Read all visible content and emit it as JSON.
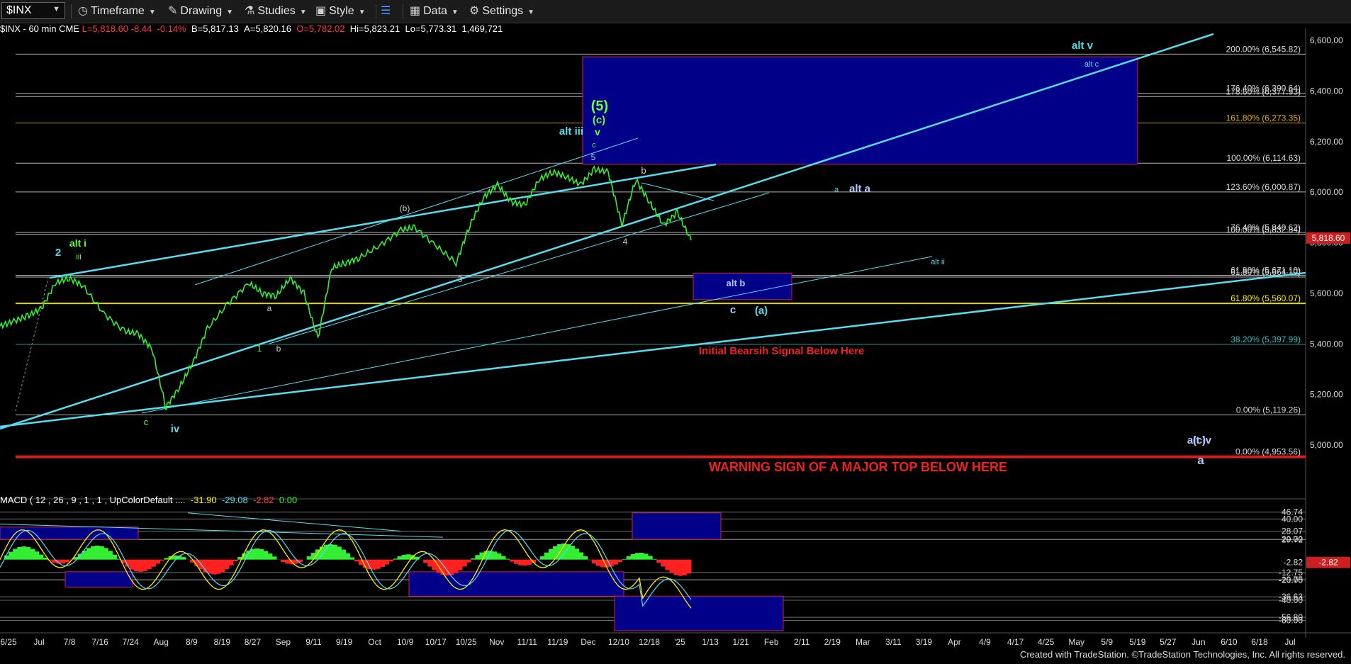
{
  "toolbar": {
    "symbol": "$INX",
    "items": [
      {
        "label": "Timeframe",
        "icon": "clock-icon"
      },
      {
        "label": "Drawing",
        "icon": "pencil-icon"
      },
      {
        "label": "Studies",
        "icon": "flask-icon"
      },
      {
        "label": "Style",
        "icon": "style-icon"
      },
      {
        "label": "",
        "icon": "panel-icon"
      },
      {
        "label": "Data",
        "icon": "bar-chart-icon"
      },
      {
        "label": "Settings",
        "icon": "gear-icon"
      }
    ]
  },
  "header": {
    "symbol": "$INX - 60 min  CME",
    "last": "L=5,818.60",
    "change": "-8.44",
    "pct": "-0.14%",
    "bid": "B=5,817.13",
    "ask": "A=5,820.16",
    "open": "O=5,782.02",
    "high": "Hi=5,823.21",
    "low": "Lo=5,773.31",
    "volume": "1,469,721"
  },
  "macd": {
    "label": "MACD ( 12 , 26 , 9 , 1 , 1 , UpColorDefault ....",
    "v1": "-31.90",
    "v2": "-29.08",
    "v3": "-2.82",
    "v4": "0.00"
  },
  "credit": "Created with TradeStation. ©TradeStation Technologies, Inc. All rights reserved.",
  "colors": {
    "price": "#33ee33",
    "cyan": "#55ddee",
    "blue_box": "#000088",
    "red": "#ee2222",
    "yellow": "#ffee00",
    "green_label": "#66ff33"
  },
  "chart_data": {
    "type": "line",
    "title": "",
    "x_ticks": [
      "6/25",
      "Jul",
      "7/8",
      "7/16",
      "7/24",
      "Aug",
      "8/9",
      "8/19",
      "8/27",
      "Sep",
      "9/11",
      "9/19",
      "Oct",
      "10/9",
      "10/17",
      "10/25",
      "Nov",
      "11/11",
      "11/19",
      "Dec",
      "12/10",
      "12/18",
      "'25",
      "1/13",
      "1/21",
      "Feb",
      "2/11",
      "2/19",
      "Mar",
      "3/11",
      "3/19",
      "Apr",
      "4/9",
      "4/17",
      "4/25",
      "May",
      "5/9",
      "5/19",
      "5/27",
      "Jun",
      "6/10",
      "6/18",
      "Jul"
    ],
    "price_ticks": [
      "6,600.00",
      "6,400.00",
      "6,200.00",
      "6,000.00",
      "5,800.00",
      "5,600.00",
      "5,400.00",
      "5,200.00",
      "5,000.00"
    ],
    "price_ylim": [
      4900,
      6650
    ],
    "last_price": "5,818.60",
    "fib_levels": [
      {
        "label": "200.00% (6,545.82)",
        "value": 6545.82
      },
      {
        "label": "178.60% (6,377.93)",
        "value": 6377.93
      },
      {
        "label": "176.40% (6,390.64)",
        "value": 6390.64
      },
      {
        "label": "161.80% (6,273.35)",
        "value": 6273.35
      },
      {
        "label": "100.00% (6,114.63)",
        "value": 6114.63
      },
      {
        "label": "123.60% (6,000.87)",
        "value": 6000.87
      },
      {
        "label": "76.40% (5,840.62)",
        "value": 5840.62
      },
      {
        "label": "100.00% (5,832.84)",
        "value": 5832.84
      },
      {
        "label": "61.80% (5,671.10)",
        "value": 5671.1
      },
      {
        "label": "61.80% (5,664.10)",
        "value": 5664.1
      },
      {
        "label": "61.80% (5,560.07)",
        "value": 5560.07
      },
      {
        "label": "38.20% (5,397.99)",
        "value": 5397.99
      },
      {
        "label": "0.00% (5,119.26)",
        "value": 5119.26
      },
      {
        "label": "0.00% (4,953.56)",
        "value": 4953.56
      }
    ],
    "wave_labels": [
      "alt v",
      "alt c",
      "(5)",
      "(c)",
      "alt iii",
      "v",
      "c",
      "5",
      "b",
      "a",
      "alt a",
      "(b)",
      "3",
      "4",
      "a",
      "1",
      "b",
      "2",
      "alt i",
      "iii",
      "c",
      "iv",
      "alt ii",
      "alt b",
      "c",
      "(a)",
      "alt iv",
      "(c)",
      "a"
    ],
    "annotations": [
      "Initial Bearsih Signal Below Here",
      "WARNING SIGN OF A MAJOR TOP BELOW HERE"
    ],
    "price_series": {
      "name": "",
      "x": [
        0,
        0.02,
        0.04,
        0.06,
        0.08,
        0.1,
        0.12,
        0.15,
        0.18,
        0.2,
        0.22,
        0.24,
        0.26,
        0.28,
        0.3,
        0.33,
        0.36,
        0.38,
        0.4,
        0.42,
        0.44,
        0.46,
        0.48,
        0.5,
        0.52,
        0.55,
        0.58,
        0.6,
        0.63,
        0.66,
        0.68,
        0.7,
        0.72,
        0.74,
        0.76,
        0.78,
        0.8,
        0.82,
        0.84,
        0.86,
        0.88,
        0.9,
        0.92,
        0.94,
        0.96,
        0.98,
        1.0
      ],
      "y": [
        5470,
        5490,
        5510,
        5540,
        5640,
        5660,
        5630,
        5520,
        5450,
        5440,
        5380,
        5150,
        5230,
        5330,
        5460,
        5560,
        5640,
        5600,
        5590,
        5660,
        5600,
        5420,
        5700,
        5720,
        5740,
        5790,
        5850,
        5860,
        5790,
        5720,
        5870,
        5980,
        6030,
        5960,
        5950,
        6050,
        6080,
        6060,
        6030,
        6090,
        6080,
        5870,
        6050,
        5960,
        5870,
        5920,
        5810
      ]
    },
    "macd_ticks": [
      "46.74",
      "40.00",
      "28.07",
      "20.00",
      "19.72",
      "-2.82",
      "-12.75",
      "-19.75",
      "-20.00",
      "-36.63",
      "-40.00",
      "-56.80",
      "-60.00"
    ],
    "macd_ylim": [
      -70,
      50
    ]
  }
}
